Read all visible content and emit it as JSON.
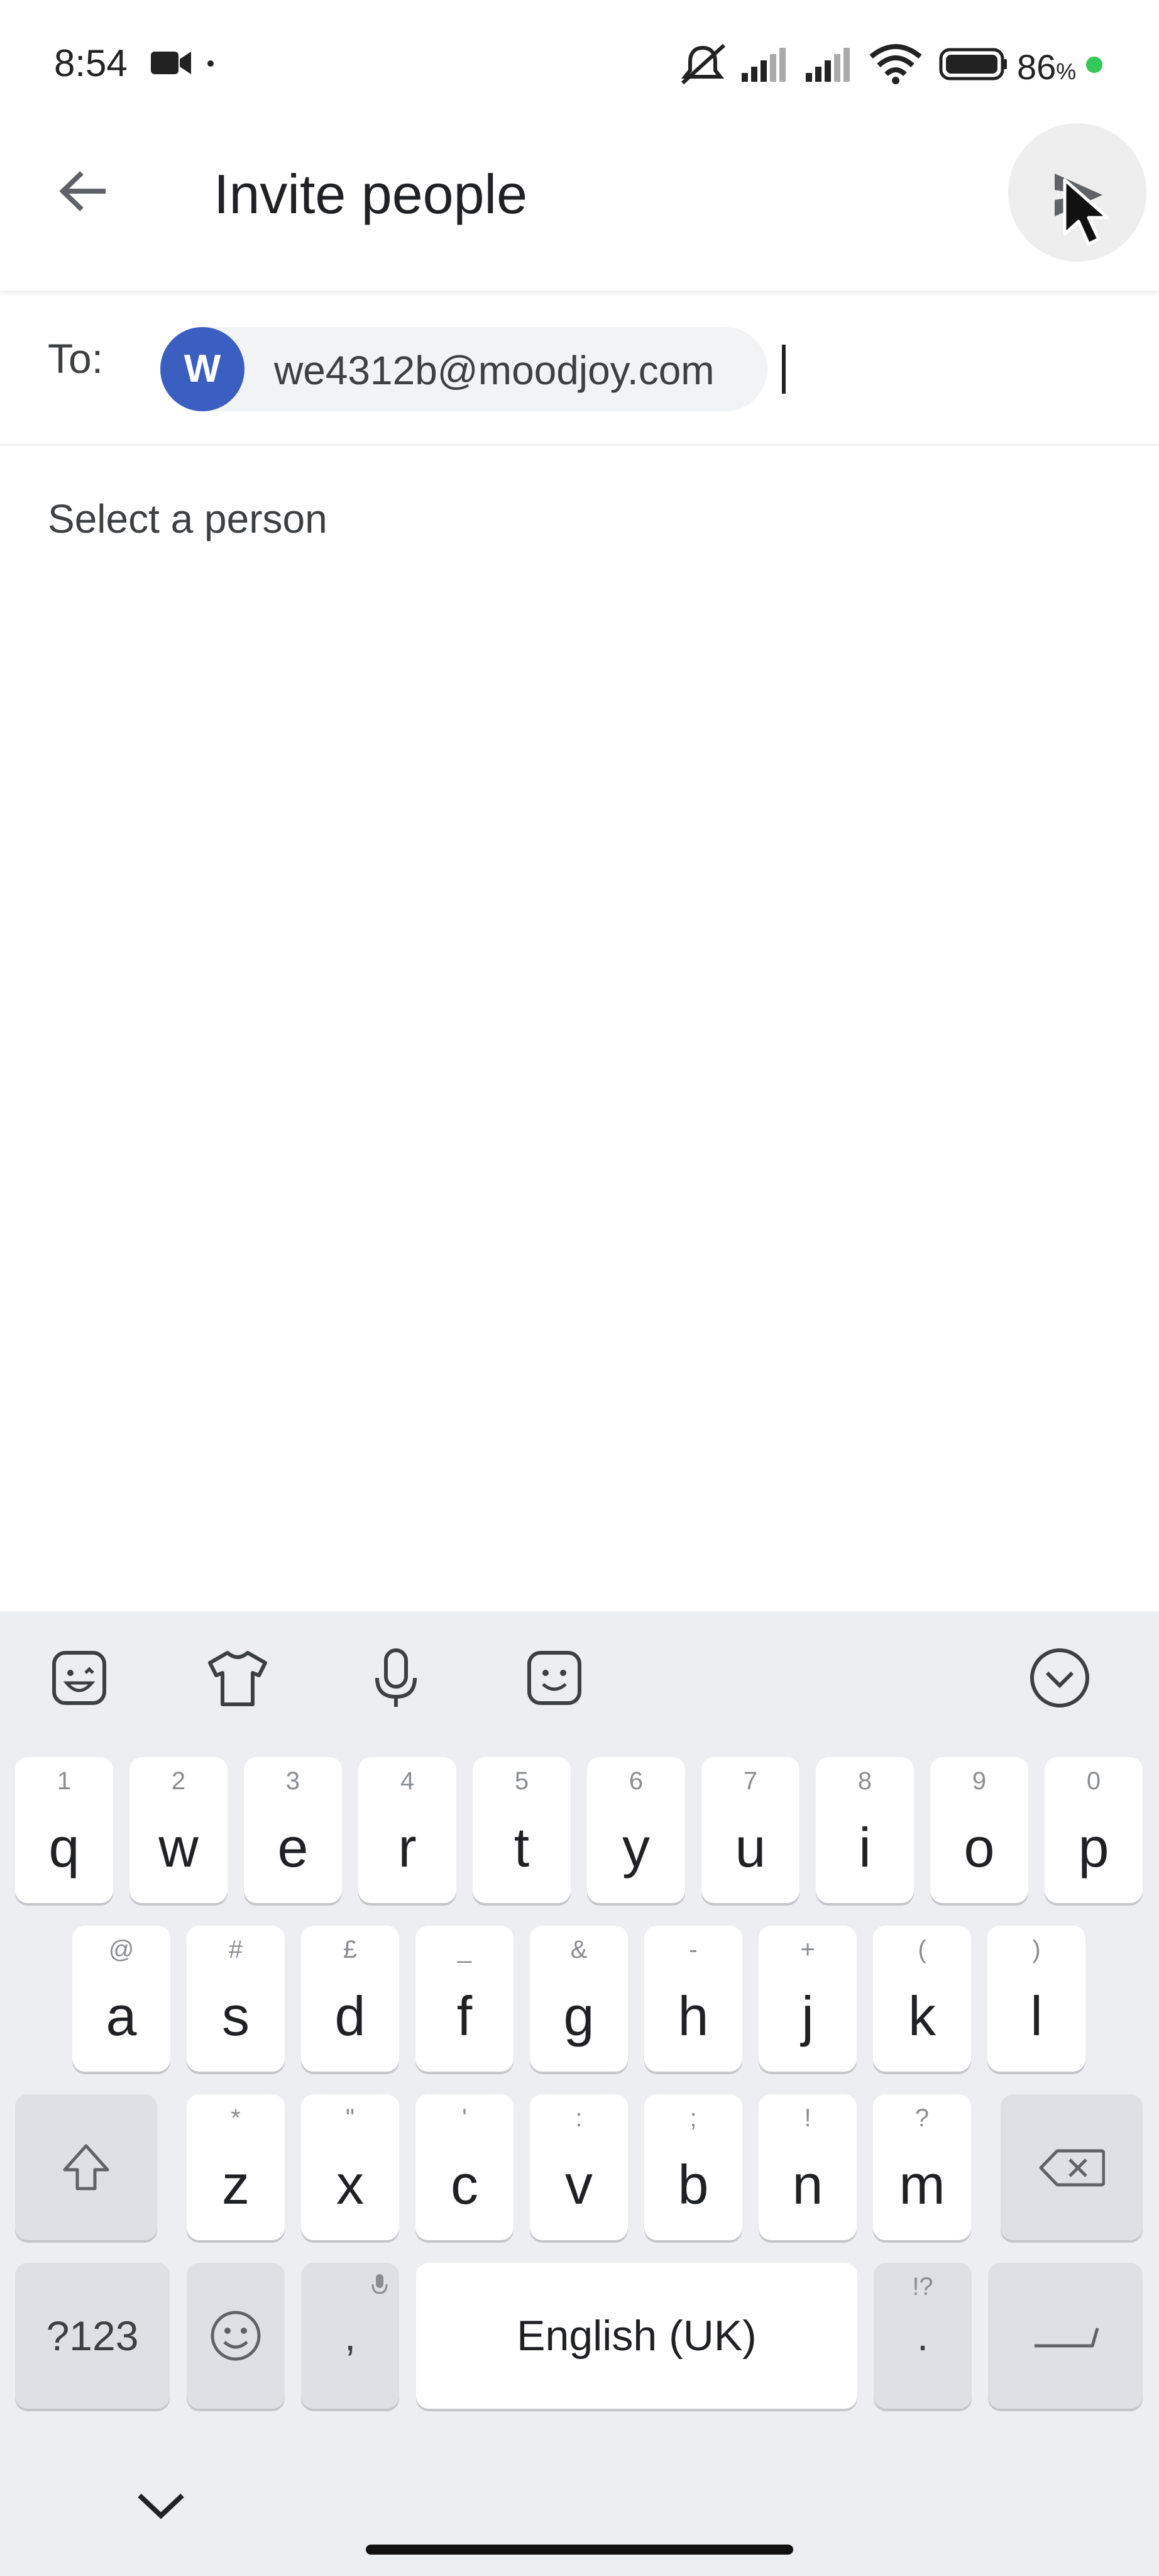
{
  "status_bar": {
    "time": "8:54",
    "battery_number": "86",
    "battery_percent_sign": "%",
    "icons": [
      "video-camera-icon",
      "dot-icon",
      "mute-vibrate-icon",
      "signal-icon",
      "signal-icon",
      "wifi-icon",
      "battery-icon",
      "green-dot-icon"
    ]
  },
  "app_bar": {
    "title": "Invite people",
    "back_icon": "arrow-back-icon",
    "send_icon": "send-icon"
  },
  "recipients": {
    "to_label": "To:",
    "chips": [
      {
        "avatar_letter": "W",
        "email": "we4312b@moodjoy.com",
        "avatar_color": "#3b5fc0"
      }
    ]
  },
  "suggestions": {
    "heading": "Select a person"
  },
  "keyboard": {
    "toolbar_icons": [
      "sticker-icon",
      "theme-shirt-icon",
      "microphone-icon",
      "emoji-face-icon",
      "collapse-keyboard-icon"
    ],
    "row1": [
      {
        "key": "q",
        "hint": "1"
      },
      {
        "key": "w",
        "hint": "2"
      },
      {
        "key": "e",
        "hint": "3"
      },
      {
        "key": "r",
        "hint": "4"
      },
      {
        "key": "t",
        "hint": "5"
      },
      {
        "key": "y",
        "hint": "6"
      },
      {
        "key": "u",
        "hint": "7"
      },
      {
        "key": "i",
        "hint": "8"
      },
      {
        "key": "o",
        "hint": "9"
      },
      {
        "key": "p",
        "hint": "0"
      }
    ],
    "row2": [
      {
        "key": "a",
        "hint": "@"
      },
      {
        "key": "s",
        "hint": "#"
      },
      {
        "key": "d",
        "hint": "£"
      },
      {
        "key": "f",
        "hint": "_"
      },
      {
        "key": "g",
        "hint": "&"
      },
      {
        "key": "h",
        "hint": "-"
      },
      {
        "key": "j",
        "hint": "+"
      },
      {
        "key": "k",
        "hint": "("
      },
      {
        "key": "l",
        "hint": ")"
      }
    ],
    "row3": [
      {
        "key": "z",
        "hint": "*"
      },
      {
        "key": "x",
        "hint": "\""
      },
      {
        "key": "c",
        "hint": "'"
      },
      {
        "key": "v",
        "hint": ":"
      },
      {
        "key": "b",
        "hint": ";"
      },
      {
        "key": "n",
        "hint": "!"
      },
      {
        "key": "m",
        "hint": "?"
      }
    ],
    "symbols_key": "?123",
    "comma_key": ",",
    "space_key": "English (UK)",
    "period_key": ".",
    "period_hint": "!?"
  },
  "colors": {
    "accent": "#3b5fc0",
    "keyboard_bg": "#eceef1"
  }
}
